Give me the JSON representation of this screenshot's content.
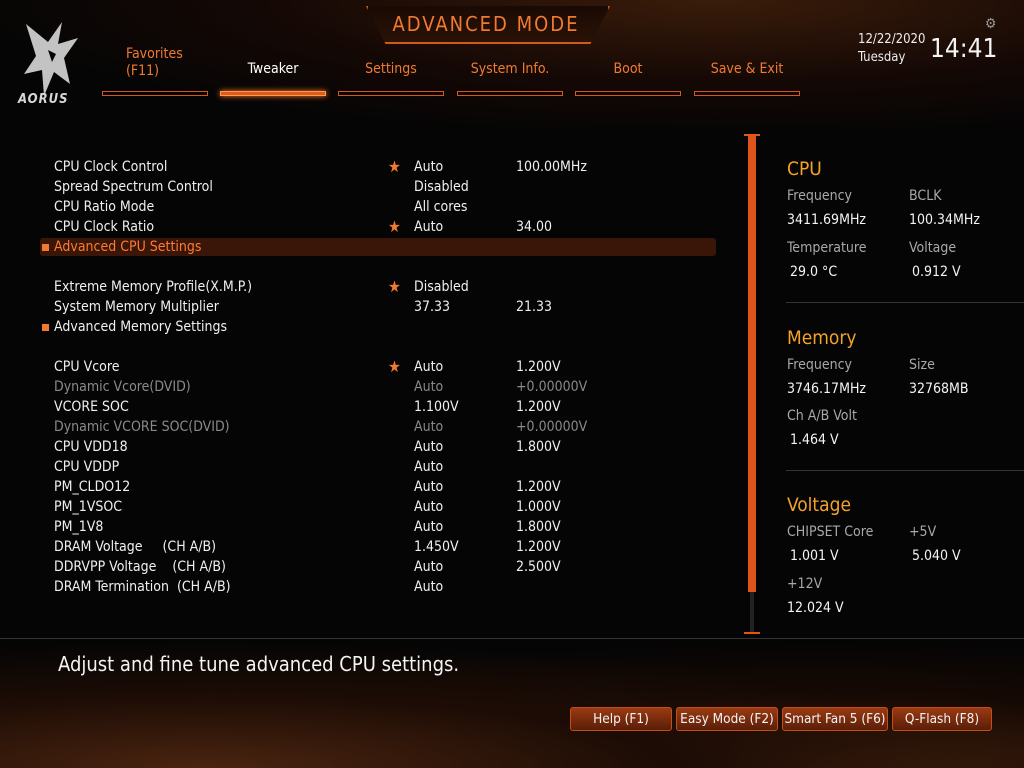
{
  "brand": {
    "logo_text": "AORUS"
  },
  "header": {
    "mode_title": "ADVANCED MODE",
    "date": "12/22/2020",
    "day": "Tuesday",
    "time": "14:41"
  },
  "tabs": [
    {
      "label": "Favorites",
      "label2": "(F11)",
      "active": false
    },
    {
      "label": "Tweaker",
      "active": true
    },
    {
      "label": "Settings",
      "active": false
    },
    {
      "label": "System Info.",
      "active": false
    },
    {
      "label": "Boot",
      "active": false
    },
    {
      "label": "Save & Exit",
      "active": false
    }
  ],
  "settings": [
    {
      "name": "CPU Clock Control",
      "star": true,
      "val1": "Auto",
      "val2": "100.00MHz"
    },
    {
      "name": "Spread Spectrum Control",
      "val1": "Disabled"
    },
    {
      "name": "CPU Ratio Mode",
      "val1": "All cores"
    },
    {
      "name": "CPU Clock Ratio",
      "star": true,
      "val1": "Auto",
      "val2": "34.00"
    },
    {
      "name": "Advanced CPU Settings",
      "submenu": true,
      "selected": true
    },
    {
      "name": "Extreme Memory Profile(X.M.P.)",
      "star": true,
      "val1": "Disabled"
    },
    {
      "name": "System Memory Multiplier",
      "val1": "37.33",
      "val2": "21.33"
    },
    {
      "name": "Advanced Memory Settings",
      "submenu": true
    },
    {
      "name": "CPU Vcore",
      "star": true,
      "val1": "Auto",
      "val2": "1.200V"
    },
    {
      "name": "Dynamic Vcore(DVID)",
      "dim": true,
      "val1": "Auto",
      "val2": "+0.00000V"
    },
    {
      "name": "VCORE SOC",
      "val1": "1.100V",
      "val2": "1.200V"
    },
    {
      "name": "Dynamic VCORE SOC(DVID)",
      "dim": true,
      "val1": "Auto",
      "val2": "+0.00000V"
    },
    {
      "name": "CPU VDD18",
      "val1": "Auto",
      "val2": "1.800V"
    },
    {
      "name": "CPU VDDP",
      "val1": "Auto"
    },
    {
      "name": "PM_CLDO12",
      "val1": "Auto",
      "val2": "1.200V"
    },
    {
      "name": "PM_1VSOC",
      "val1": "Auto",
      "val2": "1.000V"
    },
    {
      "name": "PM_1V8",
      "val1": "Auto",
      "val2": "1.800V"
    },
    {
      "name": "DRAM Voltage     (CH A/B)",
      "val1": "1.450V",
      "val2": "1.200V"
    },
    {
      "name": "DDRVPP Voltage    (CH A/B)",
      "val1": "Auto",
      "val2": "2.500V"
    },
    {
      "name": "DRAM Termination  (CH A/B)",
      "val1": "Auto"
    }
  ],
  "panel": {
    "cpu": {
      "title": "CPU",
      "freq_label": "Frequency",
      "freq": "3411.69MHz",
      "bclk_label": "BCLK",
      "bclk": "100.34MHz",
      "temp_label": "Temperature",
      "temp": "29.0 °C",
      "volt_label": "Voltage",
      "volt": "0.912 V"
    },
    "memory": {
      "title": "Memory",
      "freq_label": "Frequency",
      "freq": "3746.17MHz",
      "size_label": "Size",
      "size": "32768MB",
      "volt_label": "Ch A/B Volt",
      "volt": "1.464 V"
    },
    "voltage": {
      "title": "Voltage",
      "chipset_label": "CHIPSET Core",
      "chipset": "1.001 V",
      "p5v_label": "+5V",
      "p5v": "5.040 V",
      "p12v_label": "+12V",
      "p12v": "12.024 V"
    }
  },
  "help_text": "Adjust and fine tune advanced CPU settings.",
  "footer_buttons": [
    "Help (F1)",
    "Easy Mode (F2)",
    "Smart Fan 5 (F6)",
    "Q-Flash (F8)"
  ],
  "colors": {
    "accent": "#f07a30",
    "panel_title": "#f5a22a",
    "selected_bg": "#3a1608"
  }
}
